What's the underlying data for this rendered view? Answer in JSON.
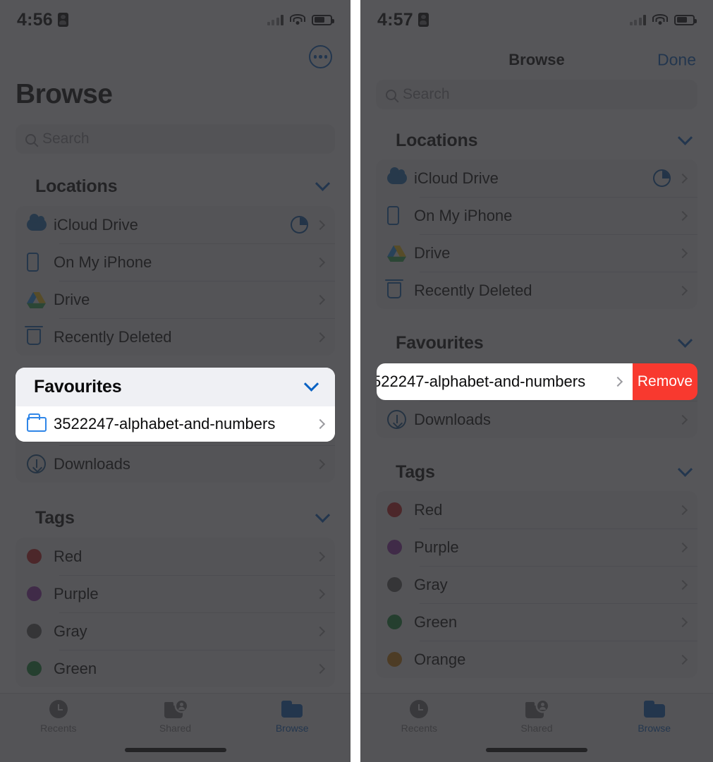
{
  "left_panel": {
    "status_bar": {
      "time": "4:56",
      "battery_icon": "battery-icon",
      "wifi_icon": "wifi-icon",
      "signal_icon": "cellular-signal-icon"
    },
    "more_button": "more-options-icon",
    "title": "Browse",
    "search": {
      "placeholder": "Search"
    },
    "sections": [
      {
        "title": "Locations",
        "rows": [
          {
            "label": "iCloud Drive",
            "icon": "icloud-icon",
            "accessory": "storage-pie-icon"
          },
          {
            "label": "On My iPhone",
            "icon": "iphone-icon",
            "accessory": ""
          },
          {
            "label": "Drive",
            "icon": "google-drive-icon",
            "accessory": ""
          },
          {
            "label": "Recently Deleted",
            "icon": "trash-icon",
            "accessory": ""
          }
        ]
      },
      {
        "title": "Favourites",
        "rows": [
          {
            "label": "3522247-alphabet-and-numbers",
            "icon": "folder-icon",
            "accessory": ""
          },
          {
            "label": "Downloads",
            "icon": "download-icon",
            "accessory": ""
          }
        ]
      },
      {
        "title": "Tags",
        "rows": [
          {
            "label": "Red",
            "icon": "tag-dot-icon",
            "color": "#c41e23"
          },
          {
            "label": "Purple",
            "icon": "tag-dot-icon",
            "color": "#8e2fa8"
          },
          {
            "label": "Gray",
            "icon": "tag-dot-icon",
            "color": "#5a5a5e"
          },
          {
            "label": "Green",
            "icon": "tag-dot-icon",
            "color": "#12873a"
          }
        ]
      }
    ],
    "tab_bar": [
      {
        "label": "Recents",
        "icon": "clock-icon",
        "active": false
      },
      {
        "label": "Shared",
        "icon": "shared-folder-icon",
        "active": false
      },
      {
        "label": "Browse",
        "icon": "folder-icon",
        "active": true
      }
    ]
  },
  "right_panel": {
    "status_bar": {
      "time": "4:57",
      "battery_icon": "battery-icon",
      "wifi_icon": "wifi-icon",
      "signal_icon": "cellular-signal-icon"
    },
    "nav": {
      "title": "Browse",
      "done_label": "Done"
    },
    "search": {
      "placeholder": "Search"
    },
    "sections": [
      {
        "title": "Locations",
        "rows": [
          {
            "label": "iCloud Drive",
            "icon": "icloud-icon",
            "accessory": "storage-pie-icon"
          },
          {
            "label": "On My iPhone",
            "icon": "iphone-icon",
            "accessory": ""
          },
          {
            "label": "Drive",
            "icon": "google-drive-icon",
            "accessory": ""
          },
          {
            "label": "Recently Deleted",
            "icon": "trash-icon",
            "accessory": ""
          }
        ]
      },
      {
        "title": "Favourites",
        "swiped_row": {
          "label": "522247-alphabet-and-numbers",
          "remove_label": "Remove",
          "remove_color": "#f8392f"
        },
        "rows": [
          {
            "label": "Downloads",
            "icon": "download-icon",
            "accessory": ""
          }
        ]
      },
      {
        "title": "Tags",
        "rows": [
          {
            "label": "Red",
            "icon": "tag-dot-icon",
            "color": "#c41e23"
          },
          {
            "label": "Purple",
            "icon": "tag-dot-icon",
            "color": "#8e2fa8"
          },
          {
            "label": "Gray",
            "icon": "tag-dot-icon",
            "color": "#5a5a5e"
          },
          {
            "label": "Green",
            "icon": "tag-dot-icon",
            "color": "#12873a"
          },
          {
            "label": "Orange",
            "icon": "tag-dot-icon",
            "color": "#c87a0b"
          }
        ]
      }
    ],
    "tab_bar": [
      {
        "label": "Recents",
        "icon": "clock-icon",
        "active": false
      },
      {
        "label": "Shared",
        "icon": "shared-folder-icon",
        "active": false
      },
      {
        "label": "Browse",
        "icon": "folder-icon",
        "active": true
      }
    ]
  }
}
